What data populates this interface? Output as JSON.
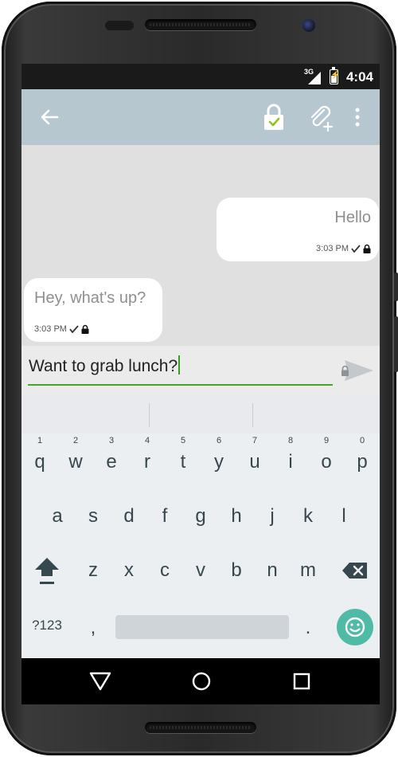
{
  "status_bar": {
    "network_type": "3G",
    "time": "4:04"
  },
  "app_bar": {
    "icons": [
      "back-arrow-icon",
      "lock-verified-icon",
      "attach-add-icon",
      "more-vert-icon"
    ]
  },
  "messages": [
    {
      "direction": "outgoing",
      "text": "Hello",
      "time": "3:03 PM",
      "status_icons": [
        "check-icon",
        "lock-icon"
      ]
    },
    {
      "direction": "incoming",
      "text": "Hey, what's up?",
      "time": "3:03 PM",
      "status_icons": [
        "check-icon",
        "lock-icon"
      ]
    }
  ],
  "composer": {
    "value": "Want to grab lunch?",
    "send_icon": "send-locked-icon"
  },
  "keyboard": {
    "row1": [
      {
        "key": "q",
        "hint": "1"
      },
      {
        "key": "w",
        "hint": "2"
      },
      {
        "key": "e",
        "hint": "3"
      },
      {
        "key": "r",
        "hint": "4"
      },
      {
        "key": "t",
        "hint": "5"
      },
      {
        "key": "y",
        "hint": "6"
      },
      {
        "key": "u",
        "hint": "7"
      },
      {
        "key": "i",
        "hint": "8"
      },
      {
        "key": "o",
        "hint": "9"
      },
      {
        "key": "p",
        "hint": "0"
      }
    ],
    "row2": [
      "a",
      "s",
      "d",
      "f",
      "g",
      "h",
      "j",
      "k",
      "l"
    ],
    "row3": [
      "z",
      "x",
      "c",
      "v",
      "b",
      "n",
      "m"
    ],
    "symbols_label": "?123",
    "comma": ",",
    "period": ".",
    "shift_icon": "shift-icon",
    "backspace_icon": "backspace-icon",
    "emoji_icon": "emoji-icon"
  },
  "nav_bar": {
    "icons": [
      "back-triangle-icon",
      "home-circle-icon",
      "recents-square-icon"
    ]
  },
  "colors": {
    "app_bar": "#b7c7d0",
    "chat_background": "#e0e0e0",
    "accent_green": "#4ba32f",
    "emoji_button": "#4fbba6",
    "keyboard_background": "#eceff1",
    "key_text": "#37474f"
  }
}
